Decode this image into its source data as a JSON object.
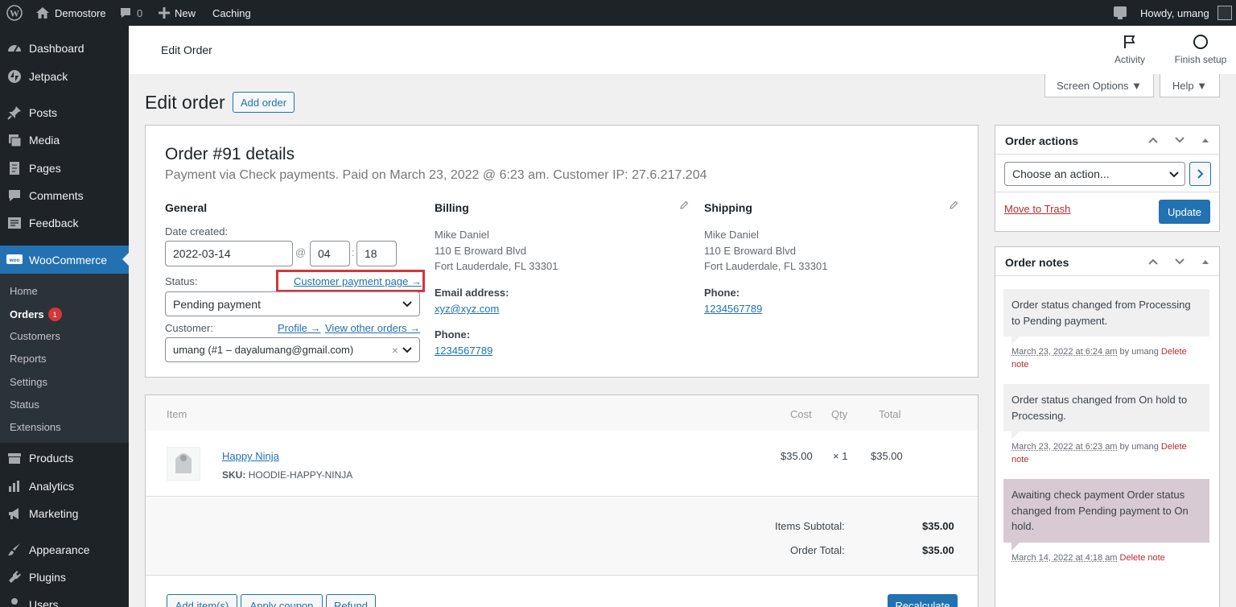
{
  "adminbar": {
    "site": "Demostore",
    "comments": "0",
    "new": "New",
    "caching": "Caching",
    "howdy": "Howdy, umang"
  },
  "sidebar": {
    "items": [
      {
        "label": "Dashboard",
        "icon": "dashboard-icon"
      },
      {
        "label": "Jetpack",
        "icon": "jetpack-icon"
      },
      {
        "label": "Posts",
        "icon": "pin-icon"
      },
      {
        "label": "Media",
        "icon": "media-icon"
      },
      {
        "label": "Pages",
        "icon": "pages-icon"
      },
      {
        "label": "Comments",
        "icon": "comment-icon"
      },
      {
        "label": "Feedback",
        "icon": "feedback-icon"
      },
      {
        "label": "WooCommerce",
        "icon": "woo-icon"
      }
    ],
    "submenu": [
      {
        "label": "Home"
      },
      {
        "label": "Orders",
        "badge": "1"
      },
      {
        "label": "Customers"
      },
      {
        "label": "Reports"
      },
      {
        "label": "Settings"
      },
      {
        "label": "Status"
      },
      {
        "label": "Extensions"
      }
    ],
    "bottom": [
      {
        "label": "Products",
        "icon": "archive-icon"
      },
      {
        "label": "Analytics",
        "icon": "chart-bar-icon"
      },
      {
        "label": "Marketing",
        "icon": "megaphone-icon"
      },
      {
        "label": "Appearance",
        "icon": "brush-icon"
      },
      {
        "label": "Plugins",
        "icon": "plugin-icon"
      },
      {
        "label": "Users",
        "icon": "users-icon"
      }
    ]
  },
  "topbar": {
    "title": "Edit Order",
    "activity": "Activity",
    "finish_setup": "Finish setup"
  },
  "screen_options": "Screen Options ▼",
  "help": "Help ▼",
  "page": {
    "title": "Edit order",
    "add_order": "Add order"
  },
  "order": {
    "heading": "Order #91 details",
    "meta": "Payment via Check payments. Paid on March 23, 2022 @ 6:23 am. Customer IP: 27.6.217.204",
    "general": {
      "title": "General",
      "date_label": "Date created:",
      "date": "2022-03-14",
      "hour": "04",
      "minute": "18",
      "status_label": "Status:",
      "payment_link": "Customer payment page →",
      "status": "Pending payment",
      "customer_label": "Customer:",
      "profile": "Profile →",
      "other_orders": "View other orders →",
      "customer": "umang (#1 – dayalumang@gmail.com)"
    },
    "billing": {
      "title": "Billing",
      "name": "Mike Daniel",
      "street": "110 E Broward Blvd",
      "city": "Fort Lauderdale, FL 33301",
      "email_label": "Email address:",
      "email": "xyz@xyz.com",
      "phone_label": "Phone:",
      "phone": "1234567789"
    },
    "shipping": {
      "title": "Shipping",
      "name": "Mike Daniel",
      "street": "110 E Broward Blvd",
      "city": "Fort Lauderdale, FL 33301",
      "phone_label": "Phone:",
      "phone": "1234567789"
    }
  },
  "items": {
    "headers": {
      "item": "Item",
      "cost": "Cost",
      "qty": "Qty",
      "total": "Total"
    },
    "rows": [
      {
        "name": "Happy Ninja",
        "sku_label": "SKU:",
        "sku": "HOODIE-HAPPY-NINJA",
        "cost": "$35.00",
        "qty": "× 1",
        "total": "$35.00"
      }
    ],
    "subtotal_label": "Items Subtotal:",
    "subtotal": "$35.00",
    "total_label": "Order Total:",
    "total": "$35.00",
    "buttons": {
      "add_items": "Add item(s)",
      "apply_coupon": "Apply coupon",
      "refund": "Refund",
      "recalculate": "Recalculate"
    }
  },
  "order_actions": {
    "title": "Order actions",
    "select": "Choose an action...",
    "trash": "Move to Trash",
    "update": "Update"
  },
  "order_notes": {
    "title": "Order notes",
    "notes": [
      {
        "text": "Order status changed from Processing to Pending payment.",
        "date": "March 23, 2022 at 6:24 am",
        "by": "by umang",
        "delete": "Delete note"
      },
      {
        "text": "Order status changed from On hold to Processing.",
        "date": "March 23, 2022 at 6:23 am",
        "by": "by umang",
        "delete": "Delete note"
      },
      {
        "text": "Awaiting check payment Order status changed from Pending payment to On hold.",
        "date": "March 14, 2022 at 4:18 am",
        "by": "",
        "delete": "Delete note"
      }
    ]
  },
  "colors": {
    "primary": "#2271b1",
    "adminbar": "#1d2327",
    "highlight": "#d63638",
    "delete": "#b32d2e",
    "customer_note": "#d7cad2"
  }
}
